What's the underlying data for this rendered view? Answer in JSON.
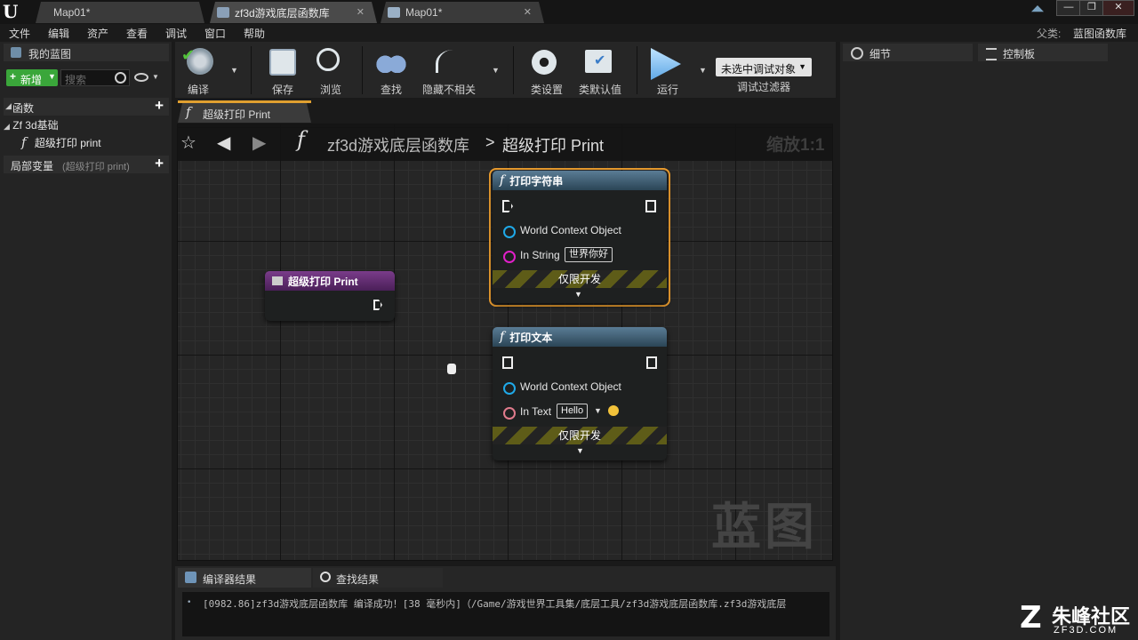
{
  "app": {
    "tabs": [
      {
        "label": "Map01*"
      },
      {
        "label": "zf3d游戏底层函数库"
      },
      {
        "label": "Map01*"
      }
    ],
    "window_controls": {
      "minimize": "—",
      "maximize": "❐",
      "close": "✕"
    }
  },
  "menu": [
    "文件",
    "编辑",
    "资产",
    "查看",
    "调试",
    "窗口",
    "帮助"
  ],
  "parent_class": {
    "label": "父类:",
    "value": "蓝图函数库"
  },
  "my_blueprint": {
    "tab_label": "我的蓝图",
    "new_button": "新增",
    "search_placeholder": "搜索",
    "functions_label": "函数",
    "category": "Zf 3d基础",
    "function_item": "超级打印 print",
    "local_vars_label": "局部变量",
    "local_vars_hint": "(超级打印 print)"
  },
  "toolbar": {
    "compile": "编译",
    "save": "保存",
    "browse": "浏览",
    "find": "查找",
    "hide_unrelated": "隐藏不相关",
    "class_settings": "类设置",
    "class_defaults": "类默认值",
    "run": "运行",
    "debug_select": "未选中调试对象",
    "debug_filter": "调试过滤器"
  },
  "graph_tab": {
    "label": "超级打印 Print"
  },
  "graph": {
    "breadcrumb_root": "zf3d游戏底层函数库",
    "breadcrumb_sep": ">",
    "breadcrumb_leaf": "超级打印 Print",
    "zoom": "缩放1:1",
    "watermark": "蓝图"
  },
  "nodes": {
    "entry": {
      "title": "超级打印 Print"
    },
    "print_string": {
      "title": "打印字符串",
      "pin_world": "World Context Object",
      "pin_string": "In String",
      "string_value": "世界你好",
      "dev_only": "仅限开发"
    },
    "print_text": {
      "title": "打印文本",
      "pin_world": "World Context Object",
      "pin_text": "In Text",
      "text_value": "Hello",
      "dev_only": "仅限开发"
    }
  },
  "right_panel": {
    "details_tab": "细节",
    "palette_tab": "控制板"
  },
  "bottom": {
    "compiler_tab": "编译器结果",
    "find_tab": "查找结果",
    "log_line": "[0982.86]zf3d游戏底层函数库 编译成功！[38 毫秒内]（/Game/游戏世界工具集/底层工具/zf3d游戏底层函数库.zf3d游戏底层"
  },
  "watermark_logo": {
    "text": "朱峰社区",
    "sub": "ZF3D.COM"
  },
  "colors": {
    "accent_orange": "#f0a030",
    "exec_pin": "#ffffff",
    "object_pin": "#1fa9e8",
    "string_pin": "#e01fc8",
    "text_pin": "#e07b8c",
    "header_blue": "#3f6277",
    "header_purple": "#5f2c70"
  }
}
